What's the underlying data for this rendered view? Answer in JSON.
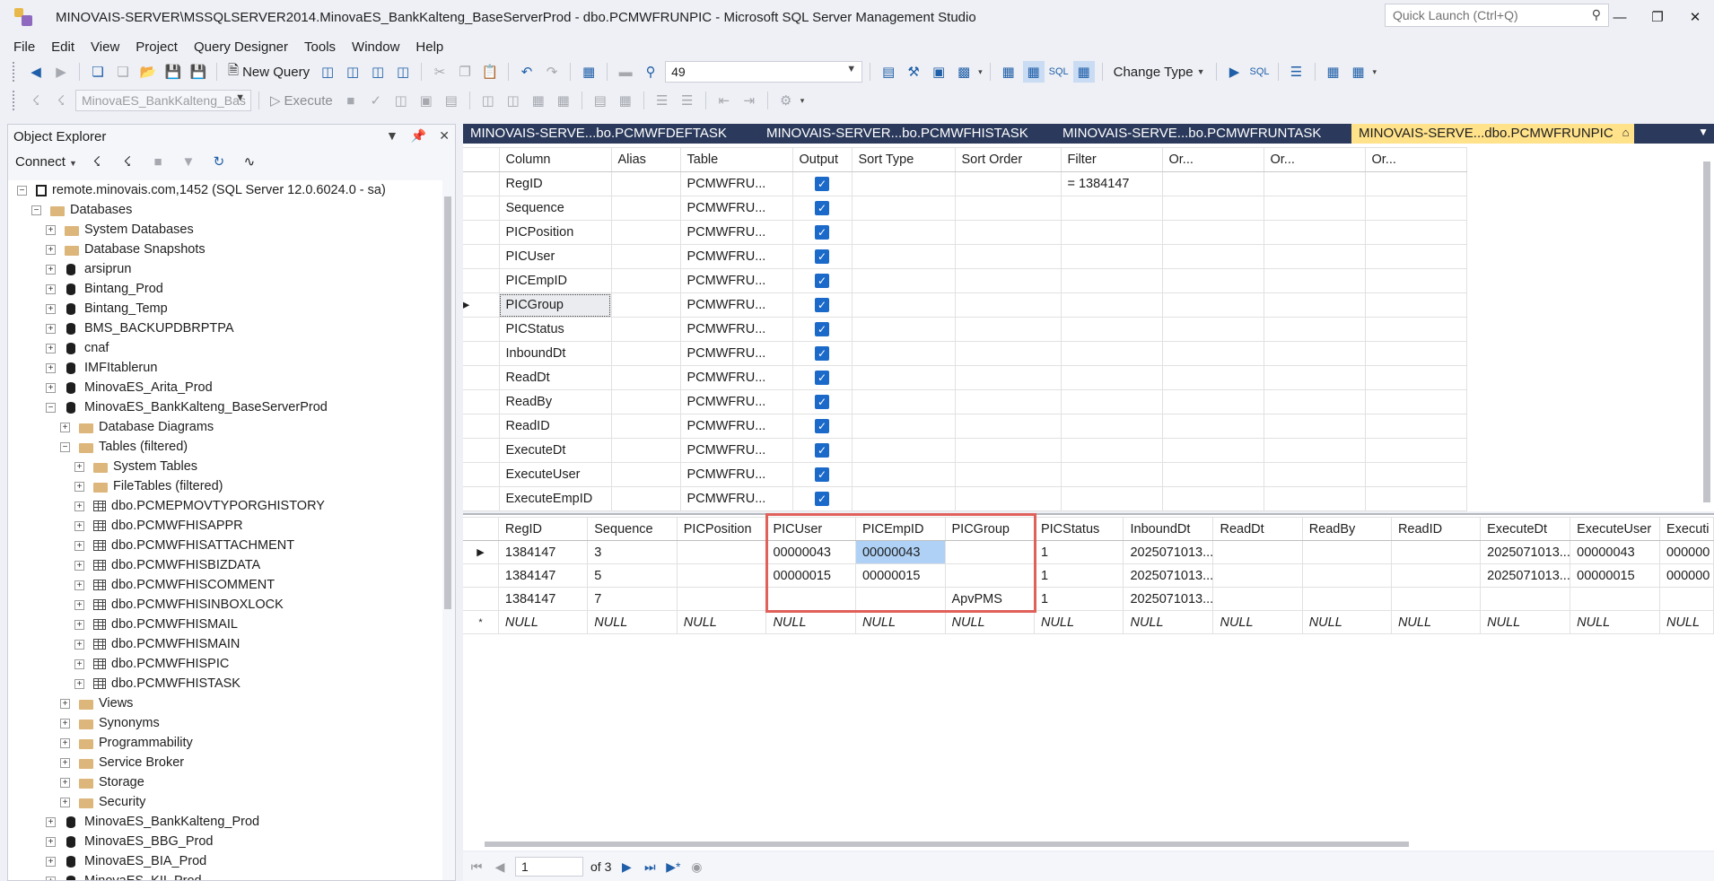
{
  "window": {
    "title": "MINOVAIS-SERVER\\MSSQLSERVER2014.MinovaES_BankKalteng_BaseServerProd - dbo.PCMWFRUNPIC - Microsoft SQL Server Management Studio",
    "quick_launch_placeholder": "Quick Launch (Ctrl+Q)"
  },
  "menu": [
    "File",
    "Edit",
    "View",
    "Project",
    "Query Designer",
    "Tools",
    "Window",
    "Help"
  ],
  "toolbar": {
    "new_query": "New Query",
    "spid_value": "49",
    "change_type": "Change Type",
    "execute": "Execute",
    "database_combo": "MinovaES_BankKalteng_Bas"
  },
  "object_explorer": {
    "title": "Object Explorer",
    "connect": "Connect",
    "tree": [
      {
        "level": 0,
        "exp": "−",
        "icon": "server",
        "label": "remote.minovais.com,1452 (SQL Server 12.0.6024.0 - sa)"
      },
      {
        "level": 1,
        "exp": "−",
        "icon": "folder",
        "label": "Databases"
      },
      {
        "level": 2,
        "exp": "+",
        "icon": "folder",
        "label": "System Databases"
      },
      {
        "level": 2,
        "exp": "+",
        "icon": "folder",
        "label": "Database Snapshots"
      },
      {
        "level": 2,
        "exp": "+",
        "icon": "db",
        "label": "arsiprun"
      },
      {
        "level": 2,
        "exp": "+",
        "icon": "db",
        "label": "Bintang_Prod"
      },
      {
        "level": 2,
        "exp": "+",
        "icon": "db",
        "label": "Bintang_Temp"
      },
      {
        "level": 2,
        "exp": "+",
        "icon": "db",
        "label": "BMS_BACKUPDBRPTPA"
      },
      {
        "level": 2,
        "exp": "+",
        "icon": "db",
        "label": "cnaf"
      },
      {
        "level": 2,
        "exp": "+",
        "icon": "db",
        "label": "IMFItablerun"
      },
      {
        "level": 2,
        "exp": "+",
        "icon": "db",
        "label": "MinovaES_Arita_Prod"
      },
      {
        "level": 2,
        "exp": "−",
        "icon": "db",
        "label": "MinovaES_BankKalteng_BaseServerProd"
      },
      {
        "level": 3,
        "exp": "+",
        "icon": "folder",
        "label": "Database Diagrams"
      },
      {
        "level": 3,
        "exp": "−",
        "icon": "folder",
        "label": "Tables (filtered)"
      },
      {
        "level": 4,
        "exp": "+",
        "icon": "folder",
        "label": "System Tables"
      },
      {
        "level": 4,
        "exp": "+",
        "icon": "folder",
        "label": "FileTables (filtered)"
      },
      {
        "level": 4,
        "exp": "+",
        "icon": "table",
        "label": "dbo.PCMEPMOVTYPORGHISTORY"
      },
      {
        "level": 4,
        "exp": "+",
        "icon": "table",
        "label": "dbo.PCMWFHISAPPR"
      },
      {
        "level": 4,
        "exp": "+",
        "icon": "table",
        "label": "dbo.PCMWFHISATTACHMENT"
      },
      {
        "level": 4,
        "exp": "+",
        "icon": "table",
        "label": "dbo.PCMWFHISBIZDATA"
      },
      {
        "level": 4,
        "exp": "+",
        "icon": "table",
        "label": "dbo.PCMWFHISCOMMENT"
      },
      {
        "level": 4,
        "exp": "+",
        "icon": "table",
        "label": "dbo.PCMWFHISINBOXLOCK"
      },
      {
        "level": 4,
        "exp": "+",
        "icon": "table",
        "label": "dbo.PCMWFHISMAIL"
      },
      {
        "level": 4,
        "exp": "+",
        "icon": "table",
        "label": "dbo.PCMWFHISMAIN"
      },
      {
        "level": 4,
        "exp": "+",
        "icon": "table",
        "label": "dbo.PCMWFHISPIC"
      },
      {
        "level": 4,
        "exp": "+",
        "icon": "table",
        "label": "dbo.PCMWFHISTASK"
      },
      {
        "level": 3,
        "exp": "+",
        "icon": "folder",
        "label": "Views"
      },
      {
        "level": 3,
        "exp": "+",
        "icon": "folder",
        "label": "Synonyms"
      },
      {
        "level": 3,
        "exp": "+",
        "icon": "folder",
        "label": "Programmability"
      },
      {
        "level": 3,
        "exp": "+",
        "icon": "folder",
        "label": "Service Broker"
      },
      {
        "level": 3,
        "exp": "+",
        "icon": "folder",
        "label": "Storage"
      },
      {
        "level": 3,
        "exp": "+",
        "icon": "folder",
        "label": "Security"
      },
      {
        "level": 2,
        "exp": "+",
        "icon": "db",
        "label": "MinovaES_BankKalteng_Prod"
      },
      {
        "level": 2,
        "exp": "+",
        "icon": "db",
        "label": "MinovaES_BBG_Prod"
      },
      {
        "level": 2,
        "exp": "+",
        "icon": "db",
        "label": "MinovaES_BIA_Prod"
      },
      {
        "level": 2,
        "exp": "+",
        "icon": "db",
        "label": "MinovaES_KII_Prod"
      }
    ]
  },
  "doc_tabs": [
    {
      "label": "MINOVAIS-SERVE...bo.PCMWFDEFTASK",
      "active": false
    },
    {
      "label": "MINOVAIS-SERVER...bo.PCMWFHISTASK",
      "active": false
    },
    {
      "label": "MINOVAIS-SERVE...bo.PCMWFRUNTASK",
      "active": false
    },
    {
      "label": "MINOVAIS-SERVE...dbo.PCMWFRUNPIC",
      "active": true
    }
  ],
  "criteria": {
    "headers": [
      "Column",
      "Alias",
      "Table",
      "Output",
      "Sort Type",
      "Sort Order",
      "Filter",
      "Or...",
      "Or...",
      "Or..."
    ],
    "rows": [
      {
        "column": "RegID",
        "table": "PCMWFRU...",
        "filter": "= 1384147"
      },
      {
        "column": "Sequence",
        "table": "PCMWFRU...",
        "filter": ""
      },
      {
        "column": "PICPosition",
        "table": "PCMWFRU...",
        "filter": ""
      },
      {
        "column": "PICUser",
        "table": "PCMWFRU...",
        "filter": ""
      },
      {
        "column": "PICEmpID",
        "table": "PCMWFRU...",
        "filter": ""
      },
      {
        "column": "PICGroup",
        "table": "PCMWFRU...",
        "filter": ""
      },
      {
        "column": "PICStatus",
        "table": "PCMWFRU...",
        "filter": ""
      },
      {
        "column": "InboundDt",
        "table": "PCMWFRU...",
        "filter": ""
      },
      {
        "column": "ReadDt",
        "table": "PCMWFRU...",
        "filter": ""
      },
      {
        "column": "ReadBy",
        "table": "PCMWFRU...",
        "filter": ""
      },
      {
        "column": "ReadID",
        "table": "PCMWFRU...",
        "filter": ""
      },
      {
        "column": "ExecuteDt",
        "table": "PCMWFRU...",
        "filter": ""
      },
      {
        "column": "ExecuteUser",
        "table": "PCMWFRU...",
        "filter": ""
      },
      {
        "column": "ExecuteEmpID",
        "table": "PCMWFRU...",
        "filter": ""
      }
    ],
    "selected_row": "PICGroup"
  },
  "results": {
    "headers": [
      "RegID",
      "Sequence",
      "PICPosition",
      "PICUser",
      "PICEmpID",
      "PICGroup",
      "PICStatus",
      "InboundDt",
      "ReadDt",
      "ReadBy",
      "ReadID",
      "ExecuteDt",
      "ExecuteUser",
      "Executi"
    ],
    "rows": [
      [
        "1384147",
        "3",
        "",
        "00000043",
        "00000043",
        "",
        "1",
        "2025071013...",
        "",
        "",
        "",
        "2025071013...",
        "00000043",
        "000000"
      ],
      [
        "1384147",
        "5",
        "",
        "00000015",
        "00000015",
        "",
        "1",
        "2025071013...",
        "",
        "",
        "",
        "2025071013...",
        "00000015",
        "000000"
      ],
      [
        "1384147",
        "7",
        "",
        "",
        "",
        "ApvPMS",
        "1",
        "2025071013...",
        "",
        "",
        "",
        "",
        "",
        ""
      ],
      [
        "NULL",
        "NULL",
        "NULL",
        "NULL",
        "NULL",
        "NULL",
        "NULL",
        "NULL",
        "NULL",
        "NULL",
        "NULL",
        "NULL",
        "NULL",
        "NULL"
      ]
    ],
    "row_markers": [
      "▶",
      "",
      "",
      "*"
    ]
  },
  "nav": {
    "page": "1",
    "of_label": "of 3"
  }
}
